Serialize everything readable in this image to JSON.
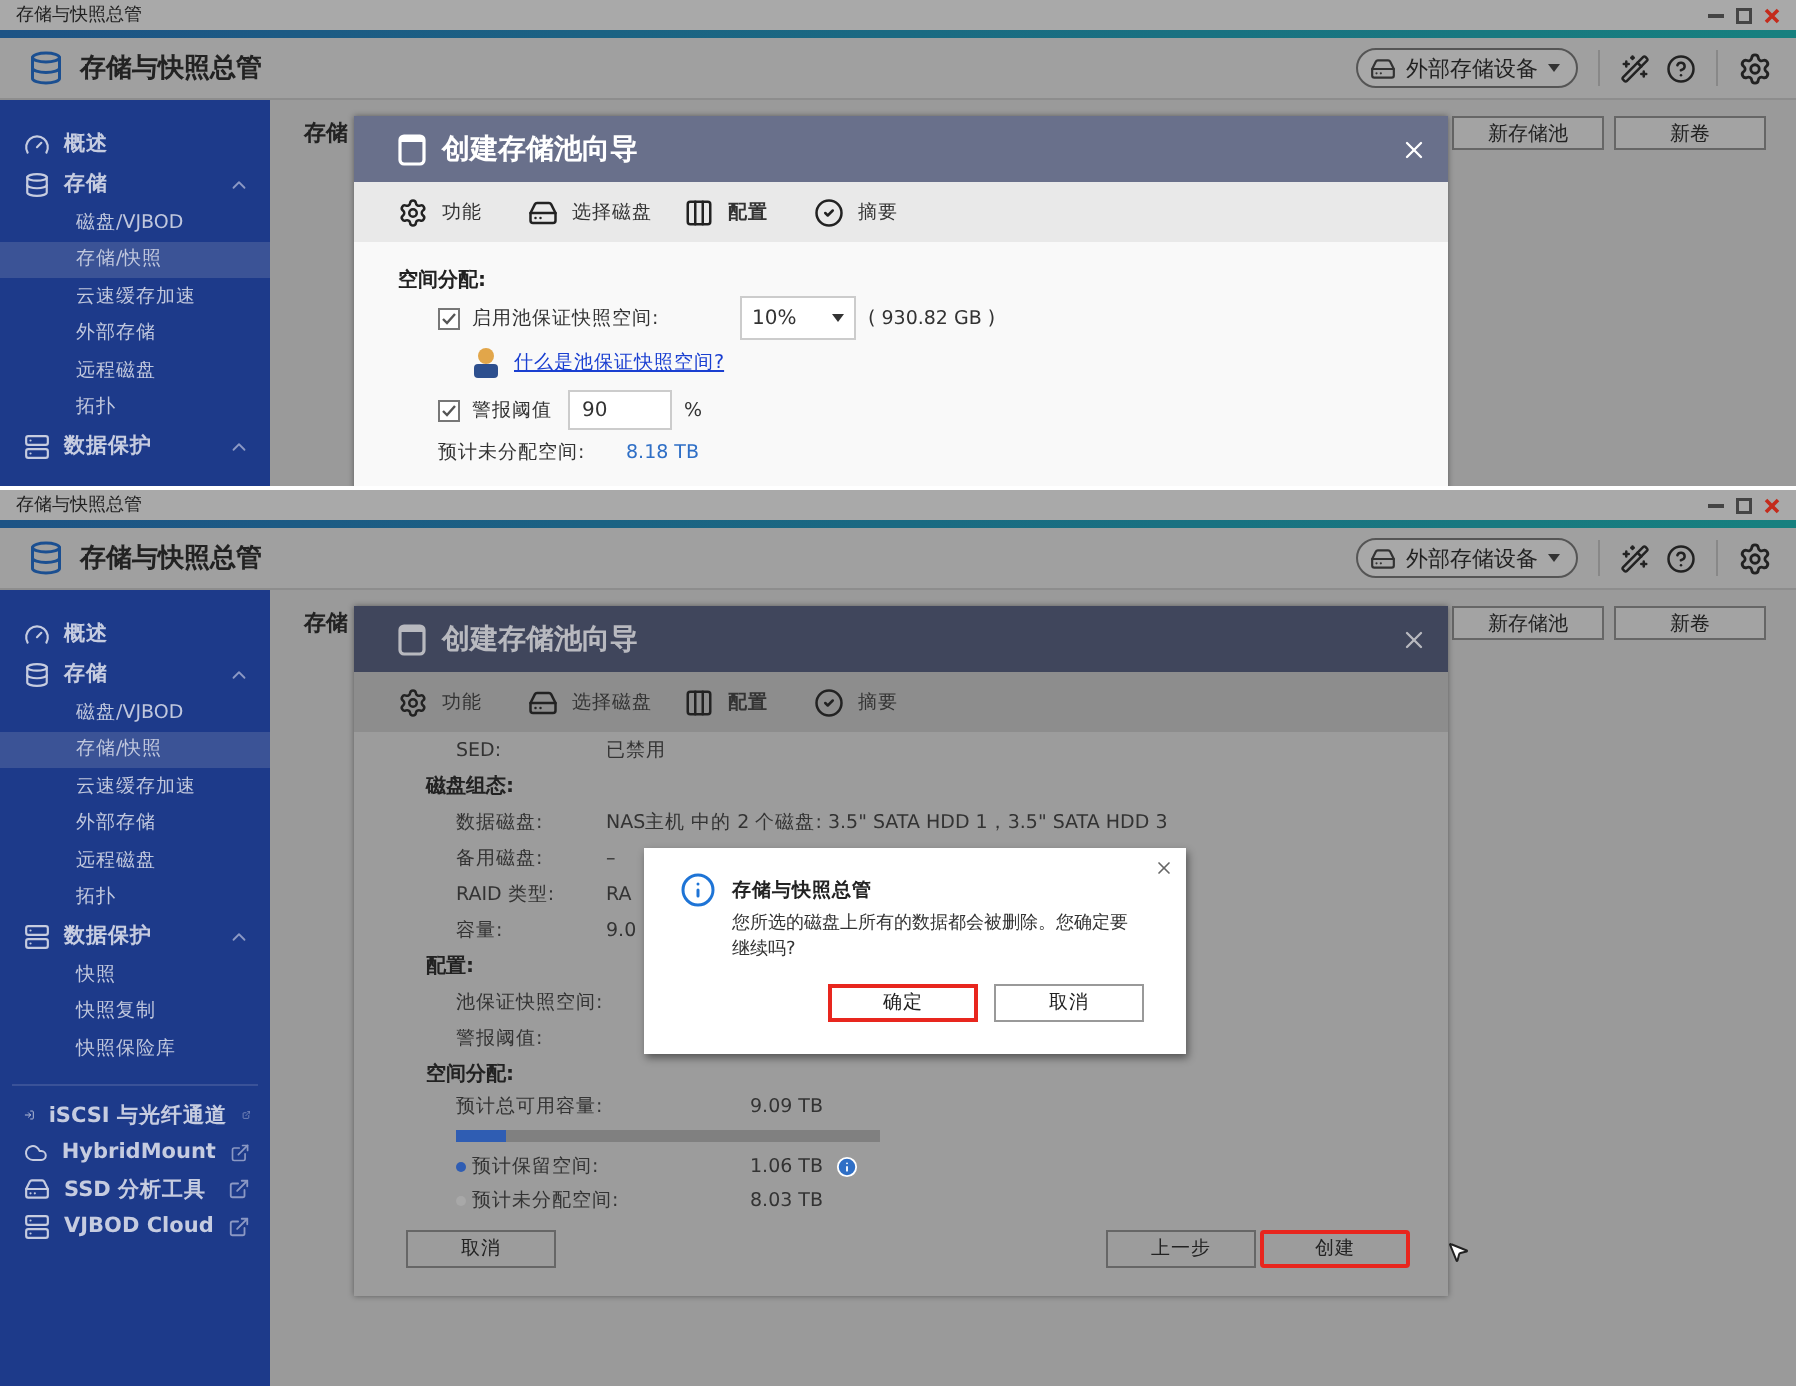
{
  "windows": [
    {
      "title": "存储与快照总管",
      "app_title": "存储与快照总管",
      "external_storage": "外部存储设备",
      "sidebar": [
        {
          "label": "概述",
          "selected": false
        },
        {
          "label": "存储",
          "expanded": true,
          "selected": false,
          "children": [
            {
              "label": "磁盘/VJBOD",
              "selected": false
            },
            {
              "label": "存储/快照",
              "selected": true
            },
            {
              "label": "云速缓存加速",
              "selected": false
            },
            {
              "label": "外部存储",
              "selected": false
            },
            {
              "label": "远程磁盘",
              "selected": false
            },
            {
              "label": "拓扑",
              "selected": false
            }
          ]
        },
        {
          "label": "数据保护",
          "expanded": true,
          "selected": false
        }
      ],
      "page_heading": "存储",
      "actions": [
        "新存储池",
        "新卷"
      ],
      "wizard": {
        "title": "创建存储池向导",
        "steps": [
          {
            "label": "功能",
            "selected": false
          },
          {
            "label": "选择磁盘",
            "selected": false
          },
          {
            "label": "配置",
            "selected": true
          },
          {
            "label": "摘要",
            "selected": false
          }
        ],
        "kind": "allocation",
        "allocation": {
          "heading": "空间分配:",
          "guarantee": {
            "checked": true,
            "label": "启用池保证快照空间:",
            "select": "10%",
            "size": "( 930.82 GB )"
          },
          "link": "什么是池保证快照空间?",
          "threshold": {
            "checked": true,
            "label": "警报阈值",
            "value": "90",
            "unit": "%"
          },
          "unallocated": {
            "label": "预计未分配空间:",
            "value": "8.18 TB"
          }
        }
      }
    },
    {
      "title": "存储与快照总管",
      "app_title": "存储与快照总管",
      "external_storage": "外部存储设备",
      "sidebar": [
        {
          "label": "概述",
          "selected": false
        },
        {
          "label": "存储",
          "expanded": true,
          "selected": false,
          "children": [
            {
              "label": "磁盘/VJBOD",
              "selected": false
            },
            {
              "label": "存储/快照",
              "selected": true
            },
            {
              "label": "云速缓存加速",
              "selected": false
            },
            {
              "label": "外部存储",
              "selected": false
            },
            {
              "label": "远程磁盘",
              "selected": false
            },
            {
              "label": "拓扑",
              "selected": false
            }
          ]
        },
        {
          "label": "数据保护",
          "expanded": true,
          "selected": false,
          "children": [
            {
              "label": "快照",
              "selected": false
            },
            {
              "label": "快照复制",
              "selected": false
            },
            {
              "label": "快照保险库",
              "selected": false
            }
          ]
        }
      ],
      "links": [
        {
          "label": "iSCSI 与光纤通道"
        },
        {
          "label": "HybridMount"
        },
        {
          "label": "SSD 分析工具"
        },
        {
          "label": "VJBOD Cloud"
        }
      ],
      "page_heading": "存储",
      "actions": [
        "新存储池",
        "新卷"
      ],
      "wizard": {
        "title": "创建存储池向导",
        "steps": [
          {
            "label": "功能",
            "selected": false
          },
          {
            "label": "选择磁盘",
            "selected": false
          },
          {
            "label": "配置",
            "selected": true
          },
          {
            "label": "摘要",
            "selected": false
          }
        ],
        "kind": "summary",
        "summary": {
          "sections": [
            {
              "rows": [
                {
                  "label": "SED:",
                  "value": "已禁用"
                }
              ]
            },
            {
              "heading": "磁盘组态:",
              "rows": [
                {
                  "label": "数据磁盘:",
                  "value": "NAS主机 中的 2 个磁盘: 3.5\" SATA HDD 1，3.5\" SATA HDD 3"
                },
                {
                  "label": "备用磁盘:",
                  "value": "–"
                },
                {
                  "label": "RAID 类型:",
                  "value": "RA"
                },
                {
                  "label": "容量:",
                  "value": "9.0"
                }
              ]
            },
            {
              "heading": "配置:",
              "rows": [
                {
                  "label": "池保证快照空间:"
                },
                {
                  "label": "警报阈值:"
                }
              ]
            }
          ],
          "space": {
            "heading": "空间分配:",
            "total_label": "预计总可用容量:",
            "total_value": "9.09 TB",
            "level": 0.12,
            "legend": [
              {
                "label": "预计保留空间:",
                "value": "1.06 TB",
                "color": "#2f5db3",
                "info": true
              },
              {
                "label": "预计未分配空间:",
                "value": "8.03 TB",
                "color": "#a8a8a8"
              }
            ]
          }
        },
        "footer": {
          "left": [
            {
              "label": "取消",
              "highlighted": false
            }
          ],
          "right": [
            {
              "label": "上一步",
              "highlighted": false
            },
            {
              "label": "创建",
              "highlighted": true
            }
          ]
        }
      },
      "confirm": {
        "title": "存储与快照总管",
        "message": "您所选的磁盘上所有的数据都会被删除。您确定要继续吗?",
        "buttons": [
          {
            "label": "确定",
            "highlighted": true
          },
          {
            "label": "取消",
            "highlighted": false
          }
        ]
      }
    }
  ]
}
